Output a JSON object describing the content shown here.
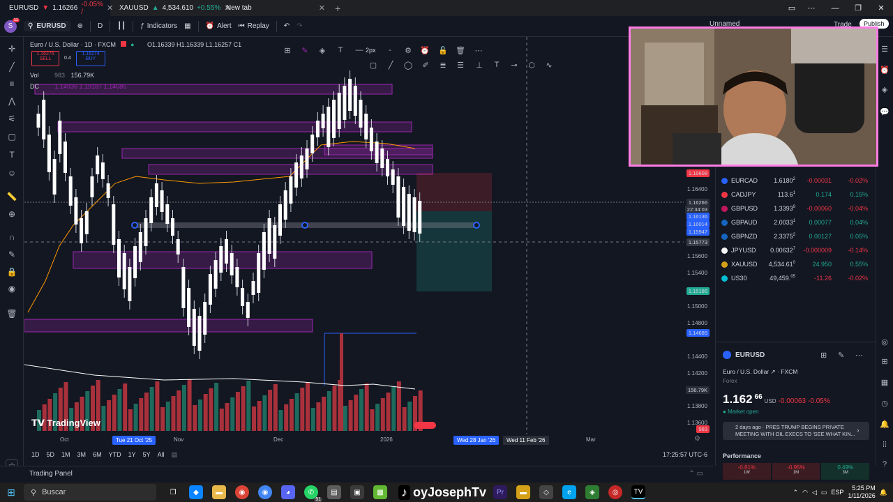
{
  "browser": {
    "tabs": [
      {
        "symbol": "EURUSD",
        "arrow": "▼",
        "price": "1.16266",
        "change": "-0.05% /",
        "active": true
      },
      {
        "symbol": "XAUUSD",
        "arrow": "▲",
        "price": "4,534.610",
        "change": "+0.55%"
      },
      {
        "title": "New tab"
      }
    ],
    "new_tab_symbol": "+"
  },
  "toolbar": {
    "avatar_letter": "S",
    "avatar_badge": "11",
    "symbol": "EURUSD",
    "interval": "D",
    "indicators_label": "Indicators",
    "alert_label": "Alert",
    "replay_label": "Replay",
    "layout_name": "Unnamed",
    "trade_label": "Trade",
    "publish_label": "Publish"
  },
  "chart": {
    "title": "Euro / U.S. Dollar · 1D · FXCM",
    "ohlc": "O1.16339  H1.16339  L1.16257  C1",
    "sell_price": "1.16275",
    "sell_label": "SELL",
    "spread": "0.4",
    "buy_price": "1.16274",
    "buy_label": "BUY",
    "vol_label": "Vol",
    "vol_value": "156.79K",
    "vol_extra": "983",
    "dc_label": "DC",
    "dc_values": "1.14936  1.19187  1.14685",
    "watermark": "TradingView",
    "line_width_label": "2px",
    "price_axis": [
      "1.16400",
      "1.16000",
      "1.15600",
      "1.15400",
      "1.15000",
      "1.14800",
      "1.14400",
      "1.14200",
      "1.13800",
      "1.13600"
    ],
    "price_tags": [
      {
        "text": "1.16608",
        "color": "#f23645"
      },
      {
        "text": "1.16266",
        "color": "#2a2e39"
      },
      {
        "text": "22:34:03",
        "color": "#2a2e39"
      },
      {
        "text": "1.16136",
        "color": "#2962ff"
      },
      {
        "text": "1.16014",
        "color": "#2962ff"
      },
      {
        "text": "1.15947",
        "color": "#2962ff"
      },
      {
        "text": "1.15773",
        "color": "#363a45"
      },
      {
        "text": "1.15186",
        "color": "#22ab94"
      },
      {
        "text": "1.14685",
        "color": "#2962ff"
      },
      {
        "text": "156.79K",
        "color": "#2a2e39"
      },
      {
        "text": "983",
        "color": "#f23645"
      }
    ],
    "time_axis": [
      "Oct",
      "Nov",
      "Dec",
      "2026",
      "Mar"
    ],
    "date_tags": [
      "Tue 21 Oct '25",
      "Wed 28 Jan '26",
      "Wed 11 Feb '26"
    ],
    "colors": {
      "up": "#ffffff",
      "down": "#ffffff",
      "zone": "#9c27b0",
      "vol_up": "#22ab94",
      "vol_down": "#f23645"
    }
  },
  "timeframes": [
    "1D",
    "5D",
    "1M",
    "3M",
    "6M",
    "YTD",
    "1Y",
    "5Y",
    "All"
  ],
  "clock": "17:25:57 UTC-6",
  "trading_panel_label": "Trading Panel",
  "watchlist": [
    {
      "symbol": "EURCAD",
      "last": "1.6180",
      "sup": "2",
      "chg": "-0.00031",
      "pct": "-0.02%",
      "dir": "down",
      "color": "#2962ff"
    },
    {
      "symbol": "CADJPY",
      "last": "113.6",
      "sup": "1",
      "chg": "0.174",
      "pct": "0.15%",
      "dir": "up",
      "color": "#f23645"
    },
    {
      "symbol": "GBPUSD",
      "last": "1.3393",
      "sup": "9",
      "chg": "-0.00060",
      "pct": "-0.04%",
      "dir": "down",
      "color": "#c2185b"
    },
    {
      "symbol": "GBPAUD",
      "last": "2.0033",
      "sup": "1",
      "chg": "0.00077",
      "pct": "0.04%",
      "dir": "up",
      "color": "#1565c0"
    },
    {
      "symbol": "GBPNZD",
      "last": "2.3375",
      "sup": "2",
      "chg": "0.00127",
      "pct": "0.05%",
      "dir": "up",
      "color": "#1565c0"
    },
    {
      "symbol": "JPYUSD",
      "last": "0.00632",
      "sup": "7",
      "chg": "-0.000009",
      "pct": "-0.14%",
      "dir": "down",
      "color": "#f5f5f5"
    },
    {
      "symbol": "XAUUSD",
      "last": "4,534.61",
      "sup": "0",
      "chg": "24.950",
      "pct": "0.55%",
      "dir": "up",
      "color": "#d4a017"
    },
    {
      "symbol": "US30",
      "last": "49,459.",
      "sup": "05",
      "chg": "-11.26",
      "pct": "-0.02%",
      "dir": "down",
      "color": "#00bcd4"
    }
  ],
  "details": {
    "symbol": "EURUSD",
    "name": "Euro / U.S. Dollar",
    "exchange": "FXCM",
    "type": "Forex",
    "price_main": "1.162",
    "price_sup": "66",
    "currency": "USD",
    "change": "-0.00063",
    "change_pct": "-0.05%",
    "market_status": "Market open",
    "news": "2 days ago · PRES TRUMP BEGINS PRIVATE MEETING WITH OIL EXECS TO 'SEE WHAT KIN...",
    "performance_label": "Performance",
    "performance": [
      {
        "value": "-0.81%",
        "period": "1W",
        "dir": "down"
      },
      {
        "value": "-0.95%",
        "period": "1M",
        "dir": "down"
      },
      {
        "value": "0.49%",
        "period": "3M",
        "dir": "up"
      }
    ]
  },
  "taskbar": {
    "search_placeholder": "Buscar",
    "overlay_name": "oyJosephTv",
    "lang": "ESP",
    "time": "5:25 PM",
    "date": "1/11/2026",
    "notif_count": "91"
  }
}
